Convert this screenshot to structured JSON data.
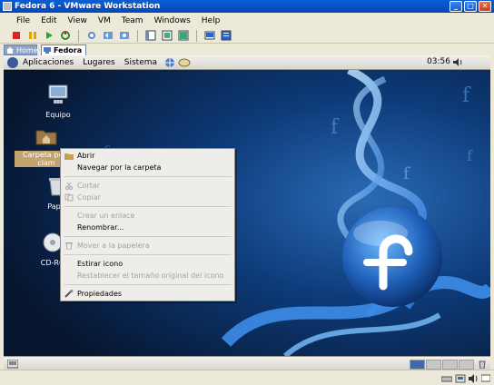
{
  "window": {
    "title": "Fedora 6 - VMware Workstation",
    "min": "_",
    "max": "□",
    "close": "✕"
  },
  "menubar": [
    "File",
    "Edit",
    "View",
    "VM",
    "Team",
    "Windows",
    "Help"
  ],
  "tabs": [
    {
      "label": "Home"
    },
    {
      "label": "Fedora 6"
    }
  ],
  "gnome_panel": {
    "menus": [
      "Aplicaciones",
      "Lugares",
      "Sistema"
    ],
    "clock": "03:56"
  },
  "desktop_icons": [
    {
      "label": "Equipo"
    },
    {
      "label": "Carpeta pe..."
    },
    {
      "label": "clam"
    },
    {
      "label": "Pape"
    },
    {
      "label": "CD-RO"
    }
  ],
  "context_menu": {
    "items": [
      {
        "label": "Abrir",
        "enabled": true,
        "icon": "folder-open-icon"
      },
      {
        "label": "Navegar por la carpeta",
        "enabled": true
      },
      {
        "label": "Cortar",
        "enabled": false,
        "icon": "cut-icon"
      },
      {
        "label": "Copiar",
        "enabled": false,
        "icon": "copy-icon"
      },
      {
        "label": "Crear un enlace",
        "enabled": false
      },
      {
        "label": "Renombrar...",
        "enabled": true
      },
      {
        "label": "Mover a la papelera",
        "enabled": false,
        "icon": "trash-icon"
      },
      {
        "label": "Estirar icono",
        "enabled": true
      },
      {
        "label": "Restablecer el tamaño original del icono",
        "enabled": false
      },
      {
        "label": "Propiedades",
        "enabled": true,
        "icon": "properties-icon"
      }
    ]
  },
  "colors": {
    "accent": "#0a5fd6",
    "desktop_bg": "#07152b",
    "selection": "#c3a46e",
    "workspace_active": "#3d6aa8"
  }
}
